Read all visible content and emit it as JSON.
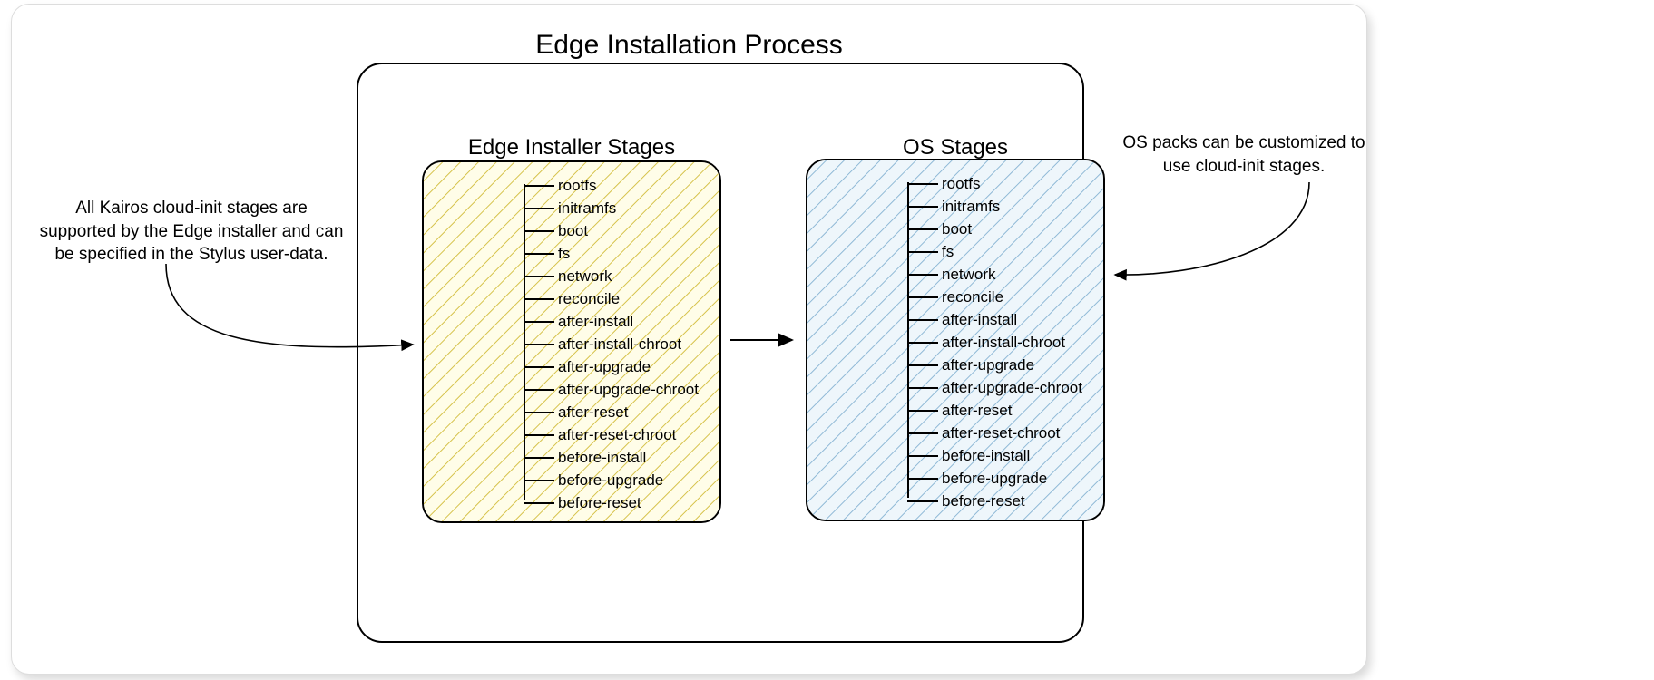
{
  "main_title": "Edge Installation Process",
  "left_box_title": "Edge Installer Stages",
  "right_box_title": "OS Stages",
  "left_note": "All Kairos cloud-init stages are supported by the Edge installer and can be specified in the Stylus user-data.",
  "right_note": "OS packs can be customized to use cloud-init stages.",
  "stages": [
    "rootfs",
    "initramfs",
    "boot",
    "fs",
    "network",
    "reconcile",
    "after-install",
    "after-install-chroot",
    "after-upgrade",
    "after-upgrade-chroot",
    "after-reset",
    "after-reset-chroot",
    "before-install",
    "before-upgrade",
    "before-reset"
  ]
}
